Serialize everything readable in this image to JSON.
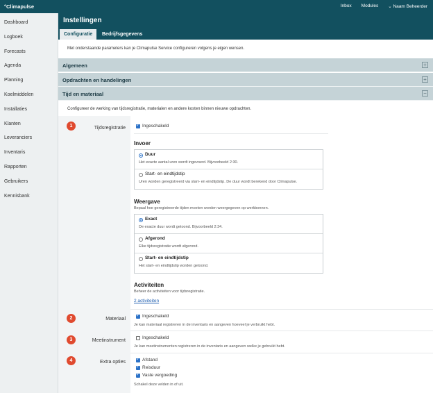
{
  "topbar": {
    "logo": "°Climapulse",
    "nav": [
      "Inbox",
      "Modules",
      "⌄ Naam Beheerder"
    ]
  },
  "sidebar": {
    "items": [
      "Dashboard",
      "Logboek",
      "Forecasts",
      "Agenda",
      "Planning",
      "Koelmiddelen",
      "Installaties",
      "Klanten",
      "Leveranciers",
      "Inventaris",
      "Rapporten",
      "Gebruikers",
      "Kennisbank"
    ]
  },
  "header": {
    "title": "Instellingen",
    "tabs": [
      "Configuratie",
      "Bedrijfsgegevens"
    ]
  },
  "main": {
    "intro": "Met onderstaande parameters kan je Climapulse Service configureren volgens je eigen wensen.",
    "sections": [
      {
        "title": "Algemeen",
        "toggle": "+"
      },
      {
        "title": "Opdrachten en handelingen",
        "toggle": "+"
      },
      {
        "title": "Tijd en materiaal",
        "toggle": "−"
      }
    ],
    "tijd_intro": "Configureer de werking van tijdsregistratie, materialen en andere kosten binnen nieuwe opdrachten."
  },
  "tijdsregistratie": {
    "badge": "1",
    "label": "Tijdsregistratie",
    "enabled_label": "Ingeschakeld",
    "invoer": {
      "title": "Invoer",
      "options": [
        {
          "title": "Duur",
          "desc": "Het exacte aantal uren wordt ingevoerd. Bijvoorbeeld 2:30."
        },
        {
          "title": "Start- en eindtijdstip",
          "desc": "Uren worden geregistreerd via start- en eindtijdstip. De duur wordt berekend door Climapulse."
        }
      ]
    },
    "weergave": {
      "title": "Weergave",
      "desc": "Bepaal hoe geregistreerde tijden moeten worden weergegeven op werkbonnen.",
      "options": [
        {
          "title": "Exact",
          "desc": "De exacte duur wordt getoond. Bijvoorbeeld 2:34."
        },
        {
          "title": "Afgerond",
          "desc": "Elke tijdsregistratie wordt afgerond."
        },
        {
          "title": "Start- en eindtijdstip",
          "desc": "Het start- en eindtijdstip worden getoond."
        }
      ]
    },
    "activiteiten": {
      "title": "Activiteiten",
      "desc": "Beheer de activiteiten voor tijdsregistratie.",
      "link": "2 activiteiten"
    }
  },
  "materiaal": {
    "badge": "2",
    "label": "Materiaal",
    "enabled_label": "Ingeschakeld",
    "desc": "Je kan materiaal registreren in de inventaris en aangeven hoeveel je verbruikt hebt."
  },
  "meetinstrument": {
    "badge": "3",
    "label": "Meetinstrument",
    "enabled_label": "Ingeschakeld",
    "desc": "Je kan meetinstrumenten registreren in de inventaris en aangeven welke je gebruikt hebt."
  },
  "extra": {
    "badge": "4",
    "label": "Extra opties",
    "options": [
      "Afstand",
      "Reisduur",
      "Vaste vergoeding"
    ],
    "desc": "Schakel deze velden in of uit."
  }
}
